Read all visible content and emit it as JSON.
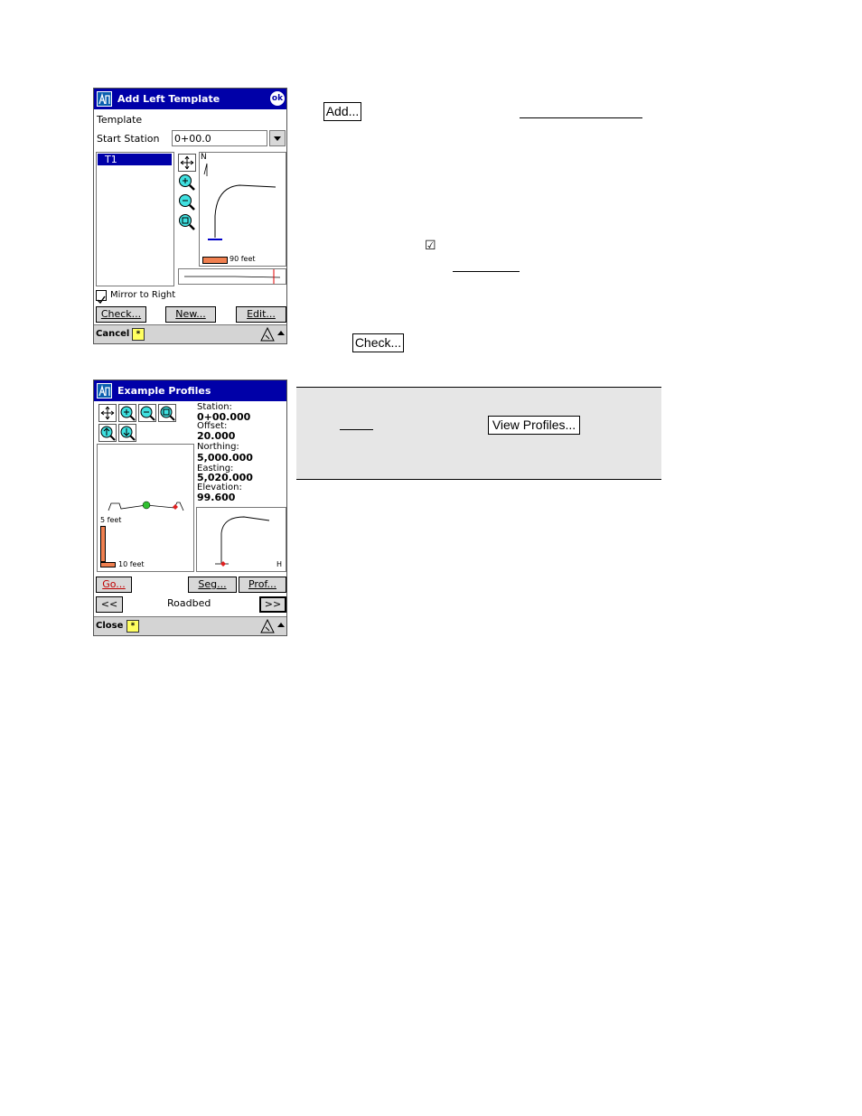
{
  "window1": {
    "title": "Add Left Template",
    "ok_label": "ok",
    "template_label": "Template",
    "start_station_label": "Start Station",
    "start_station_value": "0+00.0",
    "template_items": [
      "T1"
    ],
    "north_label": "N",
    "scale_label": "90 feet",
    "mirror_label": "Mirror to Right",
    "mirror_checked": true,
    "check_button": "Check...",
    "new_button": "New...",
    "edit_button": "Edit...",
    "cancel_label": "Cancel",
    "star_label": "*"
  },
  "window2": {
    "title": "Example Profiles",
    "station_label": "Station:",
    "station_value": "0+00.000",
    "offset_label": "Offset:",
    "offset_value": "20.000",
    "northing_label": "Northing:",
    "northing_value": "5,000.000",
    "easting_label": "Easting:",
    "easting_value": "5,020.000",
    "elevation_label": "Elevation:",
    "elevation_value": "99.600",
    "vscale_label": "5 feet",
    "hscale_label": "10 feet",
    "h_label": "H",
    "go_button": "Go...",
    "seg_button": "Seg...",
    "prof_button": "Prof...",
    "prev_button": "<<",
    "next_button": ">>",
    "section_name": "Roadbed",
    "close_label": "Close",
    "star_label": "*"
  },
  "doc": {
    "add_button": "Add...",
    "check_button": "Check...",
    "view_profiles_button": "View Profiles...",
    "checkbox_glyph": "☑"
  }
}
